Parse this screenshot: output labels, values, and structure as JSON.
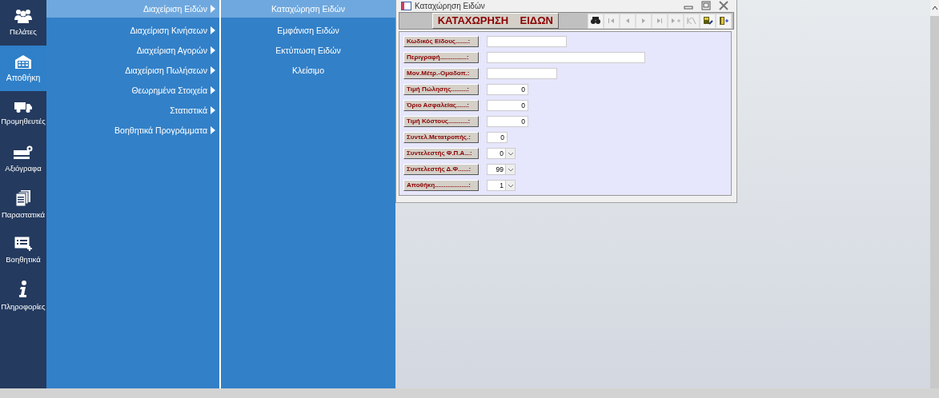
{
  "sidebar": {
    "items": [
      {
        "label": "Πελάτες",
        "selected": false
      },
      {
        "label": "Αποθήκη",
        "selected": true
      },
      {
        "label": "Προμηθευτές",
        "selected": false
      },
      {
        "label": "Αξιόγραφα",
        "selected": false
      },
      {
        "label": "Παραστατικά",
        "selected": false
      },
      {
        "label": "Βοηθητικά",
        "selected": false
      },
      {
        "label": "Πληροφορίες",
        "selected": false
      }
    ]
  },
  "menu": {
    "items": [
      {
        "label": "Διαχείριση Ειδών",
        "selected": true
      },
      {
        "label": "Διαχείριση Κινήσεων",
        "selected": false
      },
      {
        "label": "Διαχείριση Αγορών",
        "selected": false
      },
      {
        "label": "Διαχείριση Πωλήσεων",
        "selected": false
      },
      {
        "label": "Θεωρημένα Στοιχεία",
        "selected": false
      },
      {
        "label": "Στατιστικά",
        "selected": false
      },
      {
        "label": "Βοηθητικά Προγράμματα",
        "selected": false
      }
    ]
  },
  "submenu": {
    "items": [
      {
        "label": "Καταχώρηση Ειδών",
        "selected": true
      },
      {
        "label": "Εμφάνιση Ειδών",
        "selected": false
      },
      {
        "label": "Εκτύπωση Ειδών",
        "selected": false
      },
      {
        "label": "Κλείσιμο",
        "selected": false
      }
    ]
  },
  "form_window": {
    "title": "Καταχώρηση Ειδών",
    "heading": "ΚΑΤΑΧΩΡΗΣΗ    ΕΙΔΩΝ",
    "toolbar": [
      {
        "kind": "find",
        "disabled": false
      },
      {
        "kind": "first",
        "disabled": true
      },
      {
        "kind": "prev",
        "disabled": true
      },
      {
        "kind": "next",
        "disabled": true
      },
      {
        "kind": "last",
        "disabled": true
      },
      {
        "kind": "new",
        "disabled": true
      },
      {
        "kind": "undo",
        "disabled": true
      },
      {
        "kind": "save",
        "disabled": false
      },
      {
        "kind": "exit",
        "disabled": false
      }
    ],
    "fields": [
      {
        "label": "Κωδικός Είδους.......:",
        "kind": "text"
      },
      {
        "label": "Περιγραφή...............:",
        "kind": "text"
      },
      {
        "label": "Μον.Μέτρ.-Ομαδοπ.:",
        "kind": "text"
      },
      {
        "label": "Τιμή Πώλησης.........:",
        "kind": "number",
        "value": "0"
      },
      {
        "label": "Όριο Ασφαλείας......:",
        "kind": "number",
        "value": "0"
      },
      {
        "label": "Τιμή Κόστους...........:",
        "kind": "number",
        "value": "0"
      },
      {
        "label": "Συντελ.Μετατροπής.:",
        "kind": "number",
        "value": "0"
      },
      {
        "label": "Συντελεστής Φ.Π.Α...:",
        "kind": "combo",
        "value": "0"
      },
      {
        "label": "Συντελεστής Δ.Φ......:",
        "kind": "combo",
        "value": "99"
      },
      {
        "label": "Αποθήκη...................:",
        "kind": "combo",
        "value": "1"
      }
    ]
  }
}
